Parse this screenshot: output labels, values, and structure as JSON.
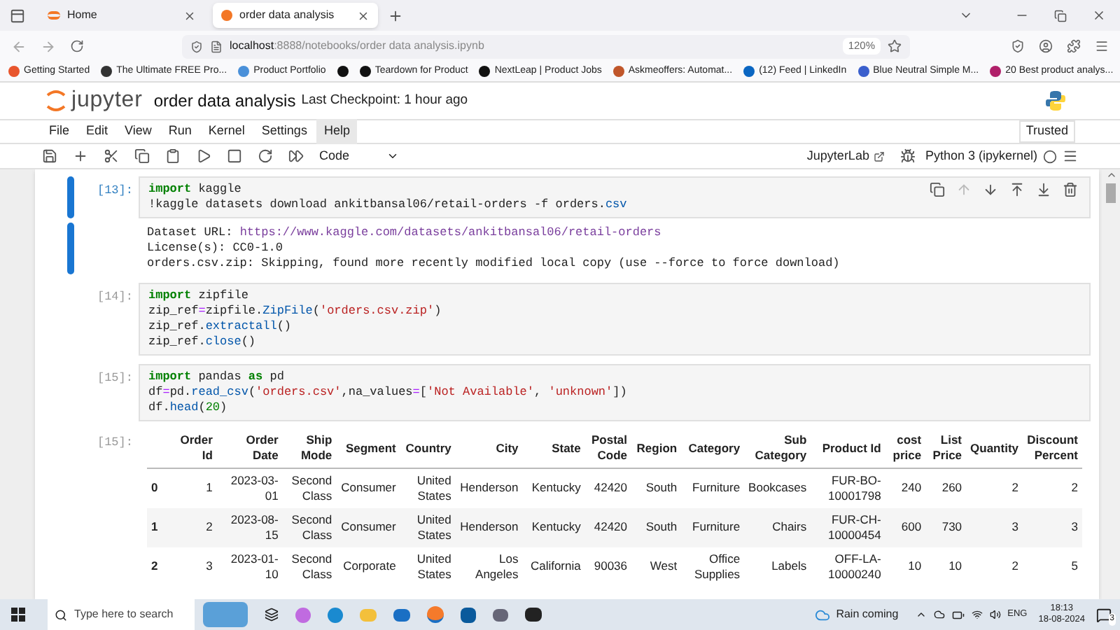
{
  "browser": {
    "tabs": [
      {
        "title": "Home",
        "selected": false
      },
      {
        "title": "order data analysis",
        "selected": true
      }
    ],
    "url_host": "localhost",
    "url_path": ":8888/notebooks/order data analysis.ipynb",
    "zoom": "120%",
    "bookmarks": [
      {
        "label": "Getting Started",
        "color": "#e8552d"
      },
      {
        "label": "The Ultimate FREE Pro...",
        "color": "#333333"
      },
      {
        "label": "Product Portfolio",
        "color": "#4a90d9"
      },
      {
        "color": "#111111"
      },
      {
        "label": "Teardown for Product",
        "color": "#111111"
      },
      {
        "label": "NextLeap | Product Jobs",
        "color": "#111111"
      },
      {
        "label": "Askmeoffers: Automat...",
        "color": "#c0562a"
      },
      {
        "label": "(12) Feed | LinkedIn",
        "color": "#0a66c2"
      },
      {
        "label": "Blue Neutral Simple M...",
        "color": "#3a5fcd"
      },
      {
        "label": "20 Best product analys...",
        "color": "#b0206a"
      }
    ]
  },
  "jupyter": {
    "logo_text": "jupyter",
    "notebook_title": "order data analysis",
    "checkpoint": "Last Checkpoint: 1 hour ago",
    "trusted": "Trusted",
    "menu": [
      {
        "label": "File",
        "selected": false
      },
      {
        "label": "Edit",
        "selected": false
      },
      {
        "label": "View",
        "selected": false
      },
      {
        "label": "Run",
        "selected": false
      },
      {
        "label": "Kernel",
        "selected": false
      },
      {
        "label": "Settings",
        "selected": false
      },
      {
        "label": "Help",
        "selected": true
      }
    ],
    "cell_type": "Code",
    "jupyterlab": "JupyterLab",
    "kernel": "Python 3 (ipykernel)"
  },
  "cells": [
    {
      "prompt": "[13]:",
      "selected": true,
      "lines": [
        [
          {
            "kind": "keyword",
            "text": "import"
          },
          {
            "kind": "plain",
            "text": " kaggle"
          }
        ],
        [
          {
            "kind": "plain",
            "text": "!kaggle datasets download ankitbansal06/retail-orders -f orders."
          },
          {
            "kind": "attr",
            "text": "csv"
          }
        ]
      ],
      "output": {
        "kind": "text",
        "lines": [
          [
            {
              "kind": "plain",
              "text": "Dataset URL: "
            },
            {
              "kind": "url",
              "text": "https://www.kaggle.com/datasets/ankitbansal06/retail-orders"
            }
          ],
          [
            {
              "kind": "plain",
              "text": "License(s): CC0-1.0"
            }
          ],
          [
            {
              "kind": "plain",
              "text": "orders.csv.zip: Skipping, found more recently modified local copy (use --force to force download)"
            }
          ]
        ]
      }
    },
    {
      "prompt": "[14]:",
      "selected": false,
      "lines": [
        [
          {
            "kind": "keyword",
            "text": "import"
          },
          {
            "kind": "plain",
            "text": " zipfile"
          }
        ],
        [
          {
            "kind": "plain",
            "text": "zip_ref"
          },
          {
            "kind": "op",
            "text": "="
          },
          {
            "kind": "plain",
            "text": "zipfile."
          },
          {
            "kind": "attr",
            "text": "ZipFile"
          },
          {
            "kind": "plain",
            "text": "("
          },
          {
            "kind": "string",
            "text": "'orders.csv.zip'"
          },
          {
            "kind": "plain",
            "text": ")"
          }
        ],
        [
          {
            "kind": "plain",
            "text": "zip_ref."
          },
          {
            "kind": "attr",
            "text": "extractall"
          },
          {
            "kind": "plain",
            "text": "()"
          }
        ],
        [
          {
            "kind": "plain",
            "text": "zip_ref."
          },
          {
            "kind": "attr",
            "text": "close"
          },
          {
            "kind": "plain",
            "text": "()"
          }
        ]
      ]
    },
    {
      "prompt": "[15]:",
      "selected": false,
      "lines": [
        [
          {
            "kind": "keyword",
            "text": "import"
          },
          {
            "kind": "plain",
            "text": " pandas "
          },
          {
            "kind": "keyword",
            "text": "as"
          },
          {
            "kind": "plain",
            "text": " pd"
          }
        ],
        [
          {
            "kind": "plain",
            "text": "df"
          },
          {
            "kind": "op",
            "text": "="
          },
          {
            "kind": "plain",
            "text": "pd."
          },
          {
            "kind": "attr",
            "text": "read_csv"
          },
          {
            "kind": "plain",
            "text": "("
          },
          {
            "kind": "string",
            "text": "'orders.csv'"
          },
          {
            "kind": "plain",
            "text": ",na_values"
          },
          {
            "kind": "op",
            "text": "="
          },
          {
            "kind": "plain",
            "text": "["
          },
          {
            "kind": "string",
            "text": "'Not Available'"
          },
          {
            "kind": "plain",
            "text": ", "
          },
          {
            "kind": "string",
            "text": "'unknown'"
          },
          {
            "kind": "plain",
            "text": "])"
          }
        ],
        [
          {
            "kind": "plain",
            "text": "df."
          },
          {
            "kind": "attr",
            "text": "head"
          },
          {
            "kind": "plain",
            "text": "("
          },
          {
            "kind": "number",
            "text": "20"
          },
          {
            "kind": "plain",
            "text": ")"
          }
        ]
      ],
      "output": {
        "kind": "table",
        "prompt": "[15]:",
        "columns": [
          "Order Id",
          "Order Date",
          "Ship Mode",
          "Segment",
          "Country",
          "City",
          "State",
          "Postal Code",
          "Region",
          "Category",
          "Sub Category",
          "Product Id",
          "cost price",
          "List Price",
          "Quantity",
          "Discount Percent"
        ],
        "rows": [
          {
            "index": "0",
            "cells": [
              "1",
              "2023-03-01",
              "Second Class",
              "Consumer",
              "United States",
              "Henderson",
              "Kentucky",
              "42420",
              "South",
              "Furniture",
              "Bookcases",
              "FUR-BO-10001798",
              "240",
              "260",
              "2",
              "2"
            ]
          },
          {
            "index": "1",
            "cells": [
              "2",
              "2023-08-15",
              "Second Class",
              "Consumer",
              "United States",
              "Henderson",
              "Kentucky",
              "42420",
              "South",
              "Furniture",
              "Chairs",
              "FUR-CH-10000454",
              "600",
              "730",
              "3",
              "3"
            ]
          },
          {
            "index": "2",
            "cells": [
              "3",
              "2023-01-10",
              "Second Class",
              "Corporate",
              "United States",
              "Los Angeles",
              "California",
              "90036",
              "West",
              "Office Supplies",
              "Labels",
              "OFF-LA-10000240",
              "10",
              "10",
              "2",
              "5"
            ]
          }
        ]
      }
    }
  ],
  "taskbar": {
    "search_placeholder": "Type here to search",
    "weather": "Rain coming",
    "language": "ENG",
    "time": "18:13",
    "date": "18-08-2024",
    "notifications": "3"
  }
}
